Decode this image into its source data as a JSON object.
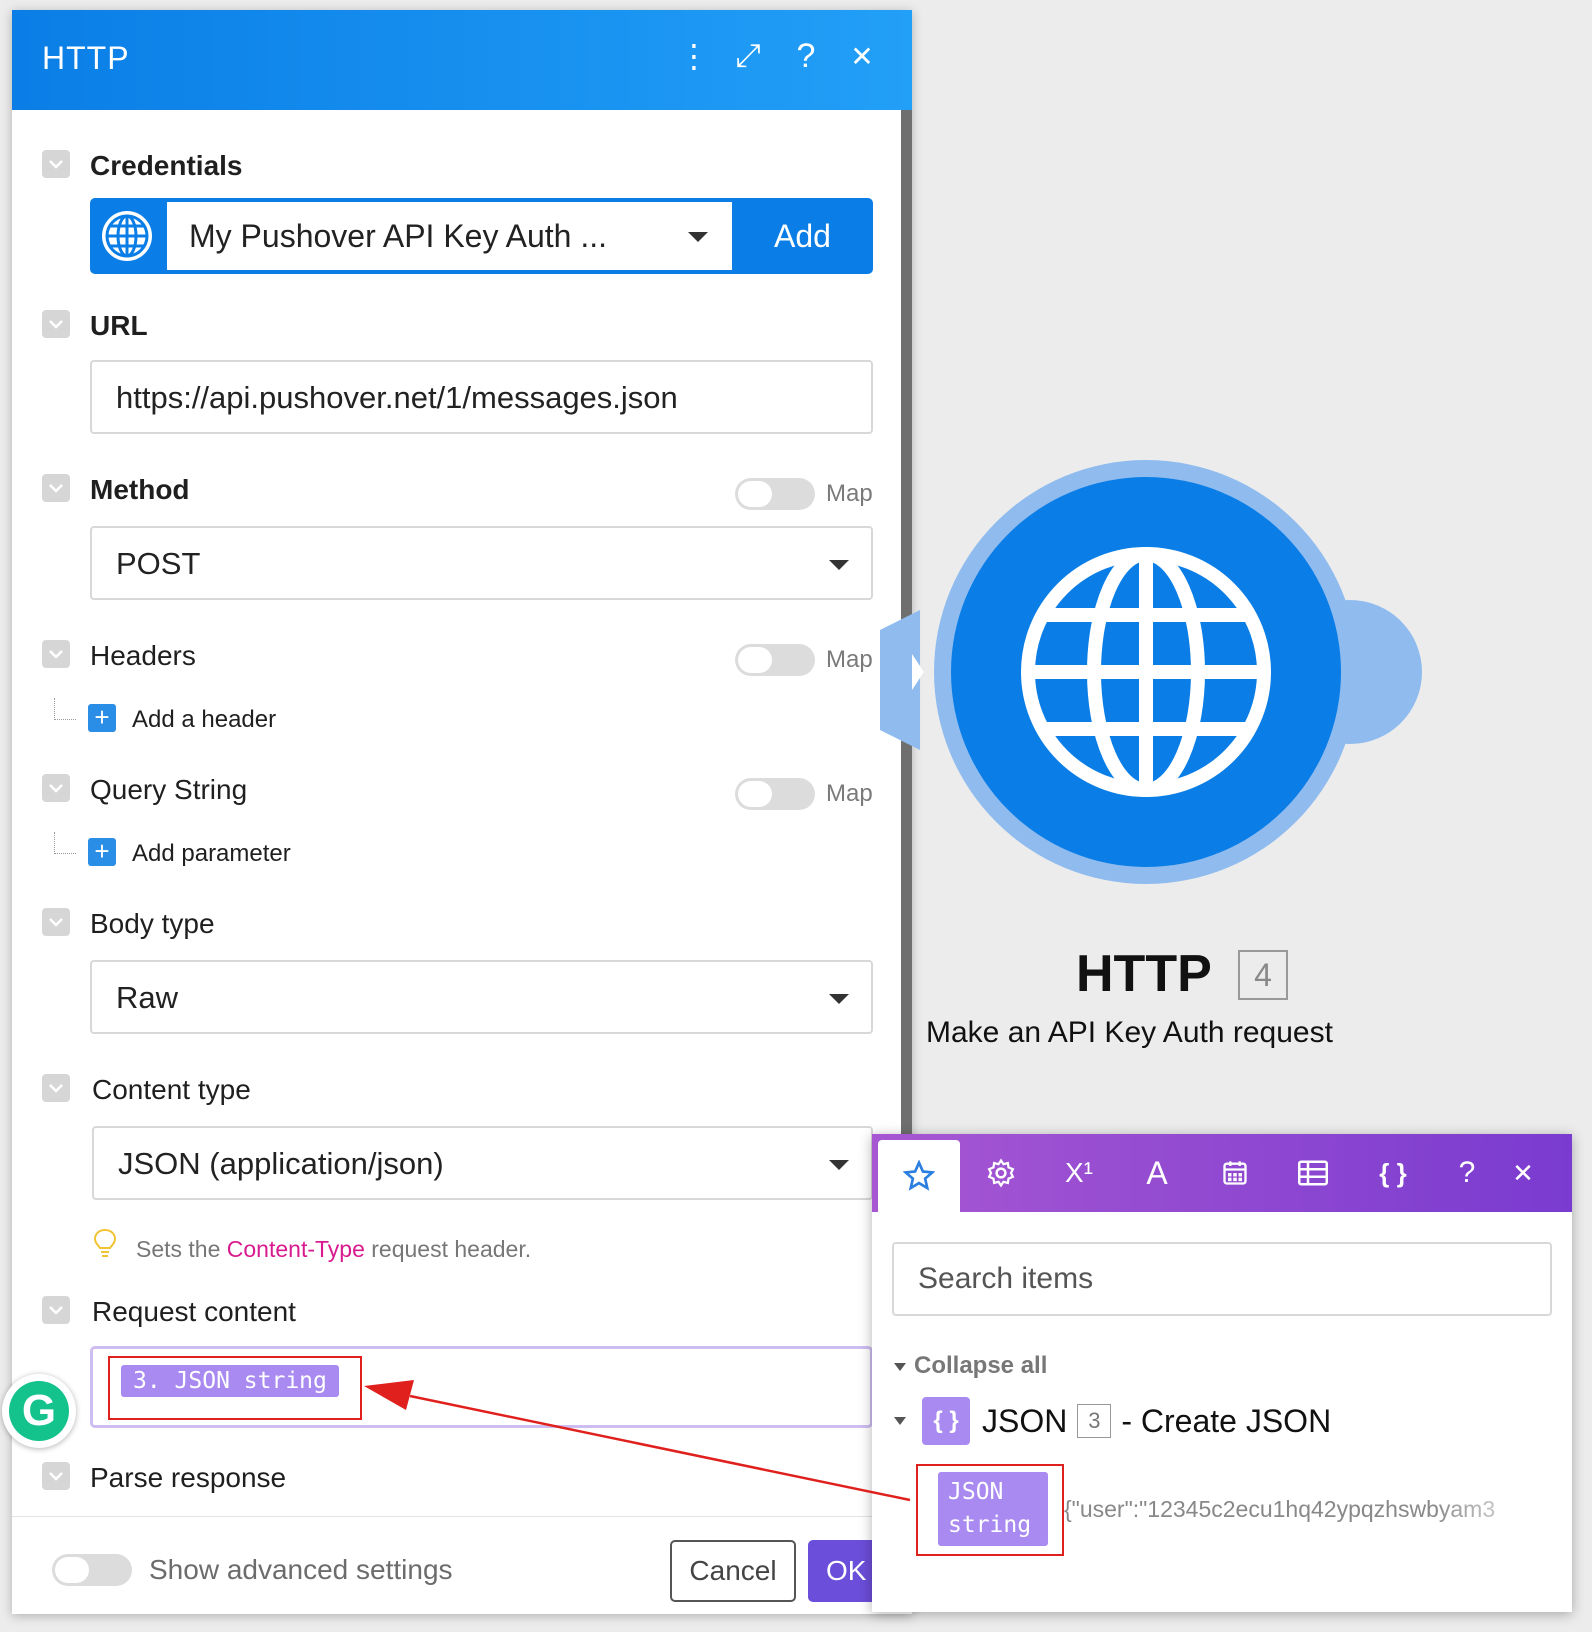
{
  "dialog": {
    "title": "HTTP",
    "header_icons": [
      "more-vertical-icon",
      "expand-icon",
      "help-icon",
      "close-icon"
    ],
    "header_glyphs": {
      "more": "⋮",
      "expand": "⤢",
      "help": "?",
      "close": "✕"
    }
  },
  "credentials": {
    "label": "Credentials",
    "selected": "My Pushover API Key Auth ...",
    "add_label": "Add"
  },
  "url": {
    "label": "URL",
    "value": "https://api.pushover.net/1/messages.json"
  },
  "method": {
    "label": "Method",
    "map_label": "Map",
    "selected": "POST"
  },
  "headers": {
    "label": "Headers",
    "map_label": "Map",
    "add_label": "Add a header"
  },
  "query_string": {
    "label": "Query String",
    "map_label": "Map",
    "add_label": "Add parameter"
  },
  "body_type": {
    "label": "Body type",
    "selected": "Raw"
  },
  "content_type": {
    "label": "Content type",
    "selected": "JSON (application/json)",
    "hint_before": "Sets the ",
    "hint_highlight": "Content-Type",
    "hint_after": " request header."
  },
  "request_content": {
    "label": "Request content",
    "token": "3. JSON string"
  },
  "parse_response": {
    "label": "Parse response"
  },
  "footer": {
    "advanced_label": "Show advanced settings",
    "cancel_label": "Cancel",
    "ok_label": "OK"
  },
  "module": {
    "title": "HTTP",
    "number": "4",
    "subtitle": "Make an API Key Auth request",
    "color": "#0a7ee6"
  },
  "mapping_panel": {
    "tabs": [
      "star-icon",
      "gear-icon",
      "superscript-icon",
      "text-icon",
      "calendar-icon",
      "table-icon",
      "braces-icon"
    ],
    "tab_glyphs": {
      "superscript": "X¹",
      "text": "A",
      "braces": "{ }"
    },
    "help_glyph": "?",
    "close_glyph": "✕",
    "search_placeholder": "Search items",
    "collapse_label": "Collapse all",
    "group": {
      "icon_glyph": "{ }",
      "name": "JSON",
      "number": "3",
      "description": "- Create JSON"
    },
    "item": {
      "label_line1": "JSON",
      "label_line2": "string",
      "value": "{\"user\":\"12345c2ecu1hq42ypqzhswbyam3"
    }
  },
  "colors": {
    "header_blue": "#0a7ee6",
    "panel_purple": "#a757d2",
    "pill_purple": "#a88af0",
    "annotation_red": "#e0201c"
  }
}
